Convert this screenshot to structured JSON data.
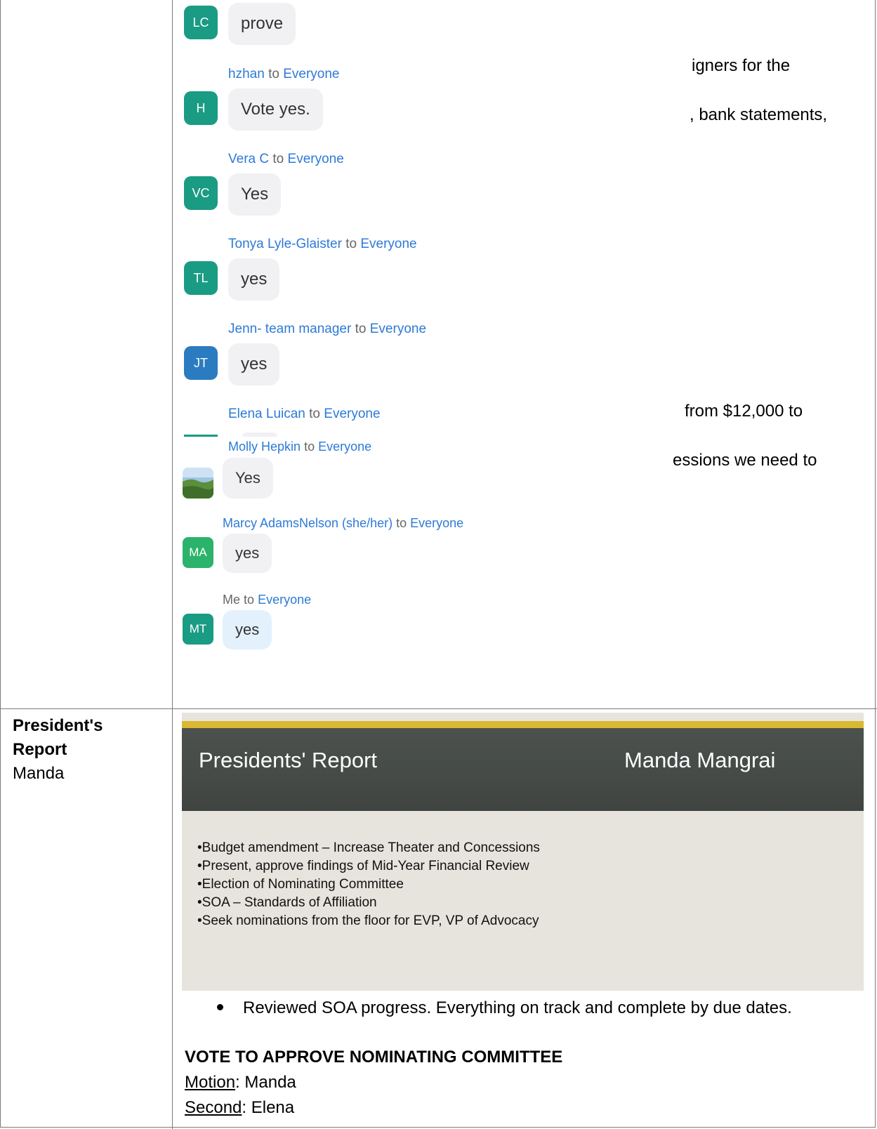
{
  "background_fragments": {
    "line1": "igners for the",
    "line2": ", bank statements,",
    "line3": "from $12,000 to",
    "line4": "essions we need to"
  },
  "chat_upper": [
    {
      "avatar": "LC",
      "avatar_color": "#1a9b83",
      "sender": "",
      "recipient": "",
      "text": "prove"
    },
    {
      "avatar": "H",
      "avatar_color": "#1a9b83",
      "sender": "hzhan",
      "recipient": "Everyone",
      "text": "Vote yes."
    },
    {
      "avatar": "VC",
      "avatar_color": "#1a9b83",
      "sender": "Vera C",
      "recipient": "Everyone",
      "text": "Yes"
    },
    {
      "avatar": "TL",
      "avatar_color": "#1a9b83",
      "sender": "Tonya Lyle-Glaister",
      "recipient": "Everyone",
      "text": "yes"
    },
    {
      "avatar": "JT",
      "avatar_color": "#2b7bc0",
      "sender": "Jenn- team manager",
      "recipient": "Everyone",
      "text": "yes"
    },
    {
      "avatar": "",
      "avatar_color": "#1a9b83",
      "sender": "Elena Luican",
      "recipient": "Everyone",
      "text": ""
    }
  ],
  "chat_lower": [
    {
      "avatar": "photo-avatar",
      "avatar_color": "",
      "sender": "Molly Hepkin",
      "recipient": "Everyone",
      "text": "Yes"
    },
    {
      "avatar": "MA",
      "avatar_color": "#2bb36b",
      "sender": "Marcy AdamsNelson (she/her)",
      "recipient": "Everyone",
      "text": "yes"
    },
    {
      "avatar": "MT",
      "avatar_color": "#1a9b83",
      "sender": "Me",
      "recipient": "Everyone",
      "text": "yes"
    }
  ],
  "to_word": "to",
  "left_cell": {
    "heading_line1": "President's",
    "heading_line2": "Report",
    "presenter": "Manda"
  },
  "slide": {
    "title": "Presidents' Report",
    "presenter": "Manda Mangrai",
    "bullets": [
      "•Budget amendment – Increase Theater and Concessions",
      "•Present, approve findings of Mid-Year Financial Review",
      "•Election of Nominating Committee",
      "•SOA – Standards of Affiliation",
      "•Seek nominations from the floor for EVP, VP of Advocacy"
    ]
  },
  "notes": {
    "bullet": "Reviewed SOA progress. Everything on track and complete by due dates.",
    "vote_title": "VOTE TO APPROVE NOMINATING COMMITTEE",
    "motion_label": "Motion",
    "motion_value": ": Manda",
    "second_label": "Second",
    "second_value": ": Elena"
  }
}
